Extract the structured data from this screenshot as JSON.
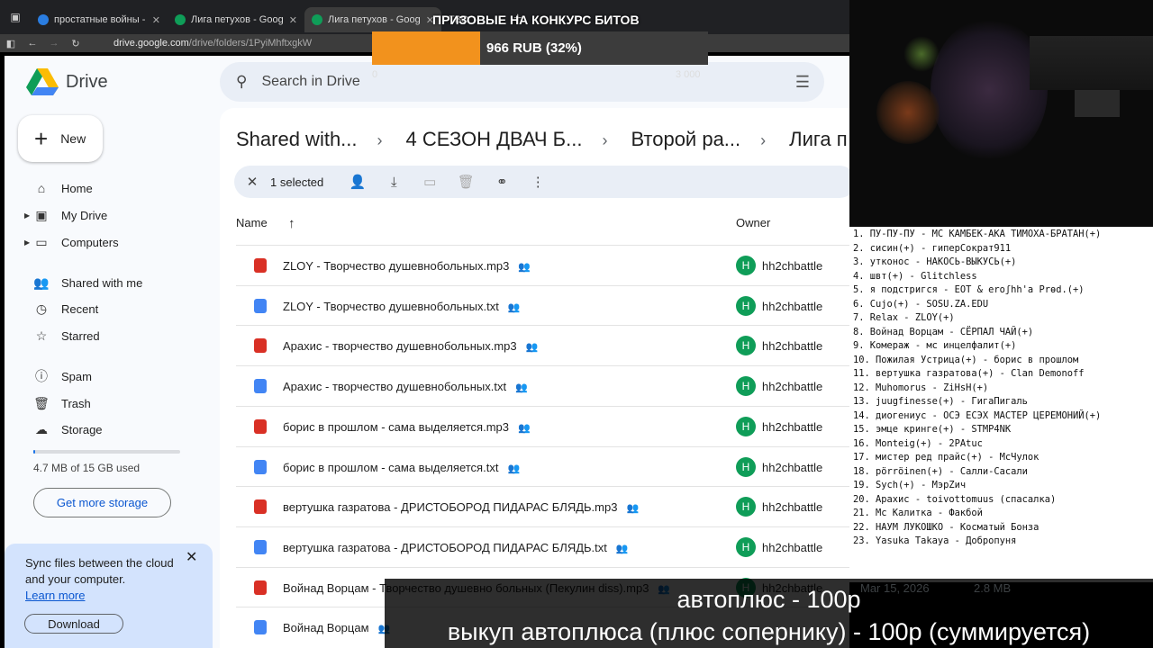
{
  "browser": {
    "tabs": [
      {
        "title": "простатные войны - Google Sh",
        "active": false,
        "color": "#2a7de1"
      },
      {
        "title": "Лига петухов - Google Drive",
        "active": false,
        "color": "#0f9d58"
      },
      {
        "title": "Лига петухов - Google Drive",
        "active": true,
        "color": "#0f9d58"
      }
    ],
    "hidden_tab": "ТВО",
    "url_host": "drive.google.com",
    "url_path": "/drive/folders/1PyiMhftxgkW"
  },
  "drive": {
    "app_name": "Drive",
    "search_placeholder": "Search in Drive",
    "new_label": "New",
    "nav": [
      {
        "label": "Home",
        "icon": "home-icon",
        "caret": false
      },
      {
        "label": "My Drive",
        "icon": "my-drive-icon",
        "caret": true
      },
      {
        "label": "Computers",
        "icon": "computer-icon",
        "caret": true
      },
      {
        "label": "Shared with me",
        "icon": "people-icon",
        "caret": false
      },
      {
        "label": "Recent",
        "icon": "clock-icon",
        "caret": false
      },
      {
        "label": "Starred",
        "icon": "star-icon",
        "caret": false
      },
      {
        "label": "Spam",
        "icon": "spam-icon",
        "caret": false
      },
      {
        "label": "Trash",
        "icon": "trash-icon",
        "caret": false
      },
      {
        "label": "Storage",
        "icon": "cloud-icon",
        "caret": false
      }
    ],
    "storage_used": "4.7 MB of 15 GB used",
    "storage_fraction": 0.0003,
    "get_more_storage": "Get more storage",
    "sync_text": "Sync files between the cloud and your computer.",
    "learn_more": "Learn more",
    "download": "Download",
    "breadcrumbs": [
      "Shared with...",
      "4 СЕЗОН ДВАЧ Б...",
      "Второй ра...",
      "Лига п"
    ],
    "selected_text": "1 selected",
    "col_name": "Name",
    "col_owner": "Owner",
    "files": [
      {
        "name": "ZLOY - Творчество душевнобольных.mp3",
        "type": "audio",
        "owner": "hh2chbattle"
      },
      {
        "name": "ZLOY - Творчество душевнобольных.txt",
        "type": "doc",
        "owner": "hh2chbattle"
      },
      {
        "name": "Арахис - творчество душевнобольных.mp3",
        "type": "audio",
        "owner": "hh2chbattle"
      },
      {
        "name": "Арахис - творчество душевнобольных.txt",
        "type": "doc",
        "owner": "hh2chbattle"
      },
      {
        "name": "борис в прошлом - сама выделяется.mp3",
        "type": "audio",
        "owner": "hh2chbattle"
      },
      {
        "name": "борис в прошлом - сама выделяется.txt",
        "type": "doc",
        "owner": "hh2chbattle"
      },
      {
        "name": "вертушка газратова - ДРИСТОБОРОД ПИДАРАС БЛЯДЬ.mp3",
        "type": "audio",
        "owner": "hh2chbattle"
      },
      {
        "name": "вертушка газратова - ДРИСТОБОРОД ПИДАРАС БЛЯДЬ.txt",
        "type": "doc",
        "owner": "hh2chbattle"
      },
      {
        "name": "Войнад Ворцам - Творчество душевно больных (Пекулин diss).mp3",
        "type": "audio",
        "owner": "hh2chbattle"
      },
      {
        "name": "Войнад Ворцам",
        "type": "doc",
        "owner": ""
      }
    ],
    "extra_date": "Mar 15, 2026",
    "extra_size": "2.8 MB",
    "owner_initial": "H"
  },
  "overlay": {
    "progress_title": "ПРИЗОВЫЕ НА КОНКУРС БИТОВ",
    "progress_value": "966 RUB (32%)",
    "progress_fraction": 0.322,
    "progress_min": "0",
    "progress_max": "3 000",
    "participants": [
      "1. ПУ-ПУ-ПУ - МС КАМБЕК-АКА ТИМОХА-БРАТАН(+)",
      "2. сисин(+) - гиперСократ911",
      "3. утконос - НАКОСЬ-ВЫКУСЬ(+)",
      "4. швт(+) - Glitchless",
      "5. я подстригся - EOT & eroʃhh'a Prɵd.(+)",
      "6. Cujo(+) - SOSU.ZA.EDU",
      "7. Relax - ZLOY(+)",
      "8. Войнад Ворцам - СЁРПАЛ ЧАЙ(+)",
      "9. Комераж - мс инцелфалит(+)",
      "10. Пожилая Устрица(+) - борис в прошлом",
      "11. вертушка газратова(+) - Clan Demonoff",
      "12. Muhomorus - ZiHsH(+)",
      "13. juugfinesse(+) - ГигаПигаль",
      "14. диогениус - ОСЭ ЕСЭХ МАСТЕР ЦЕРЕМОНИЙ(+)",
      "15. эмце кринге(+) - STMP4NK",
      "16. Monteig(+) - 2PAtuc",
      "17. мистер ред прайс(+) - МсЧулок",
      "18. pörröinen(+) - Салли-Сасали",
      "19. Sych(+) - МэрZич",
      "20. Арахис - toivottomuus (спасалка)",
      "21. Мс Калитка - Факбой",
      "22. НАУМ ЛУКОШКО - Косматый Бонза",
      "23. Yasuka Takaya - Добропуня"
    ],
    "caption_line1": "автоплюс - 100р",
    "caption_line2": "выкуп автоплюса (плюс сопернику) - 100р (суммируется)"
  }
}
